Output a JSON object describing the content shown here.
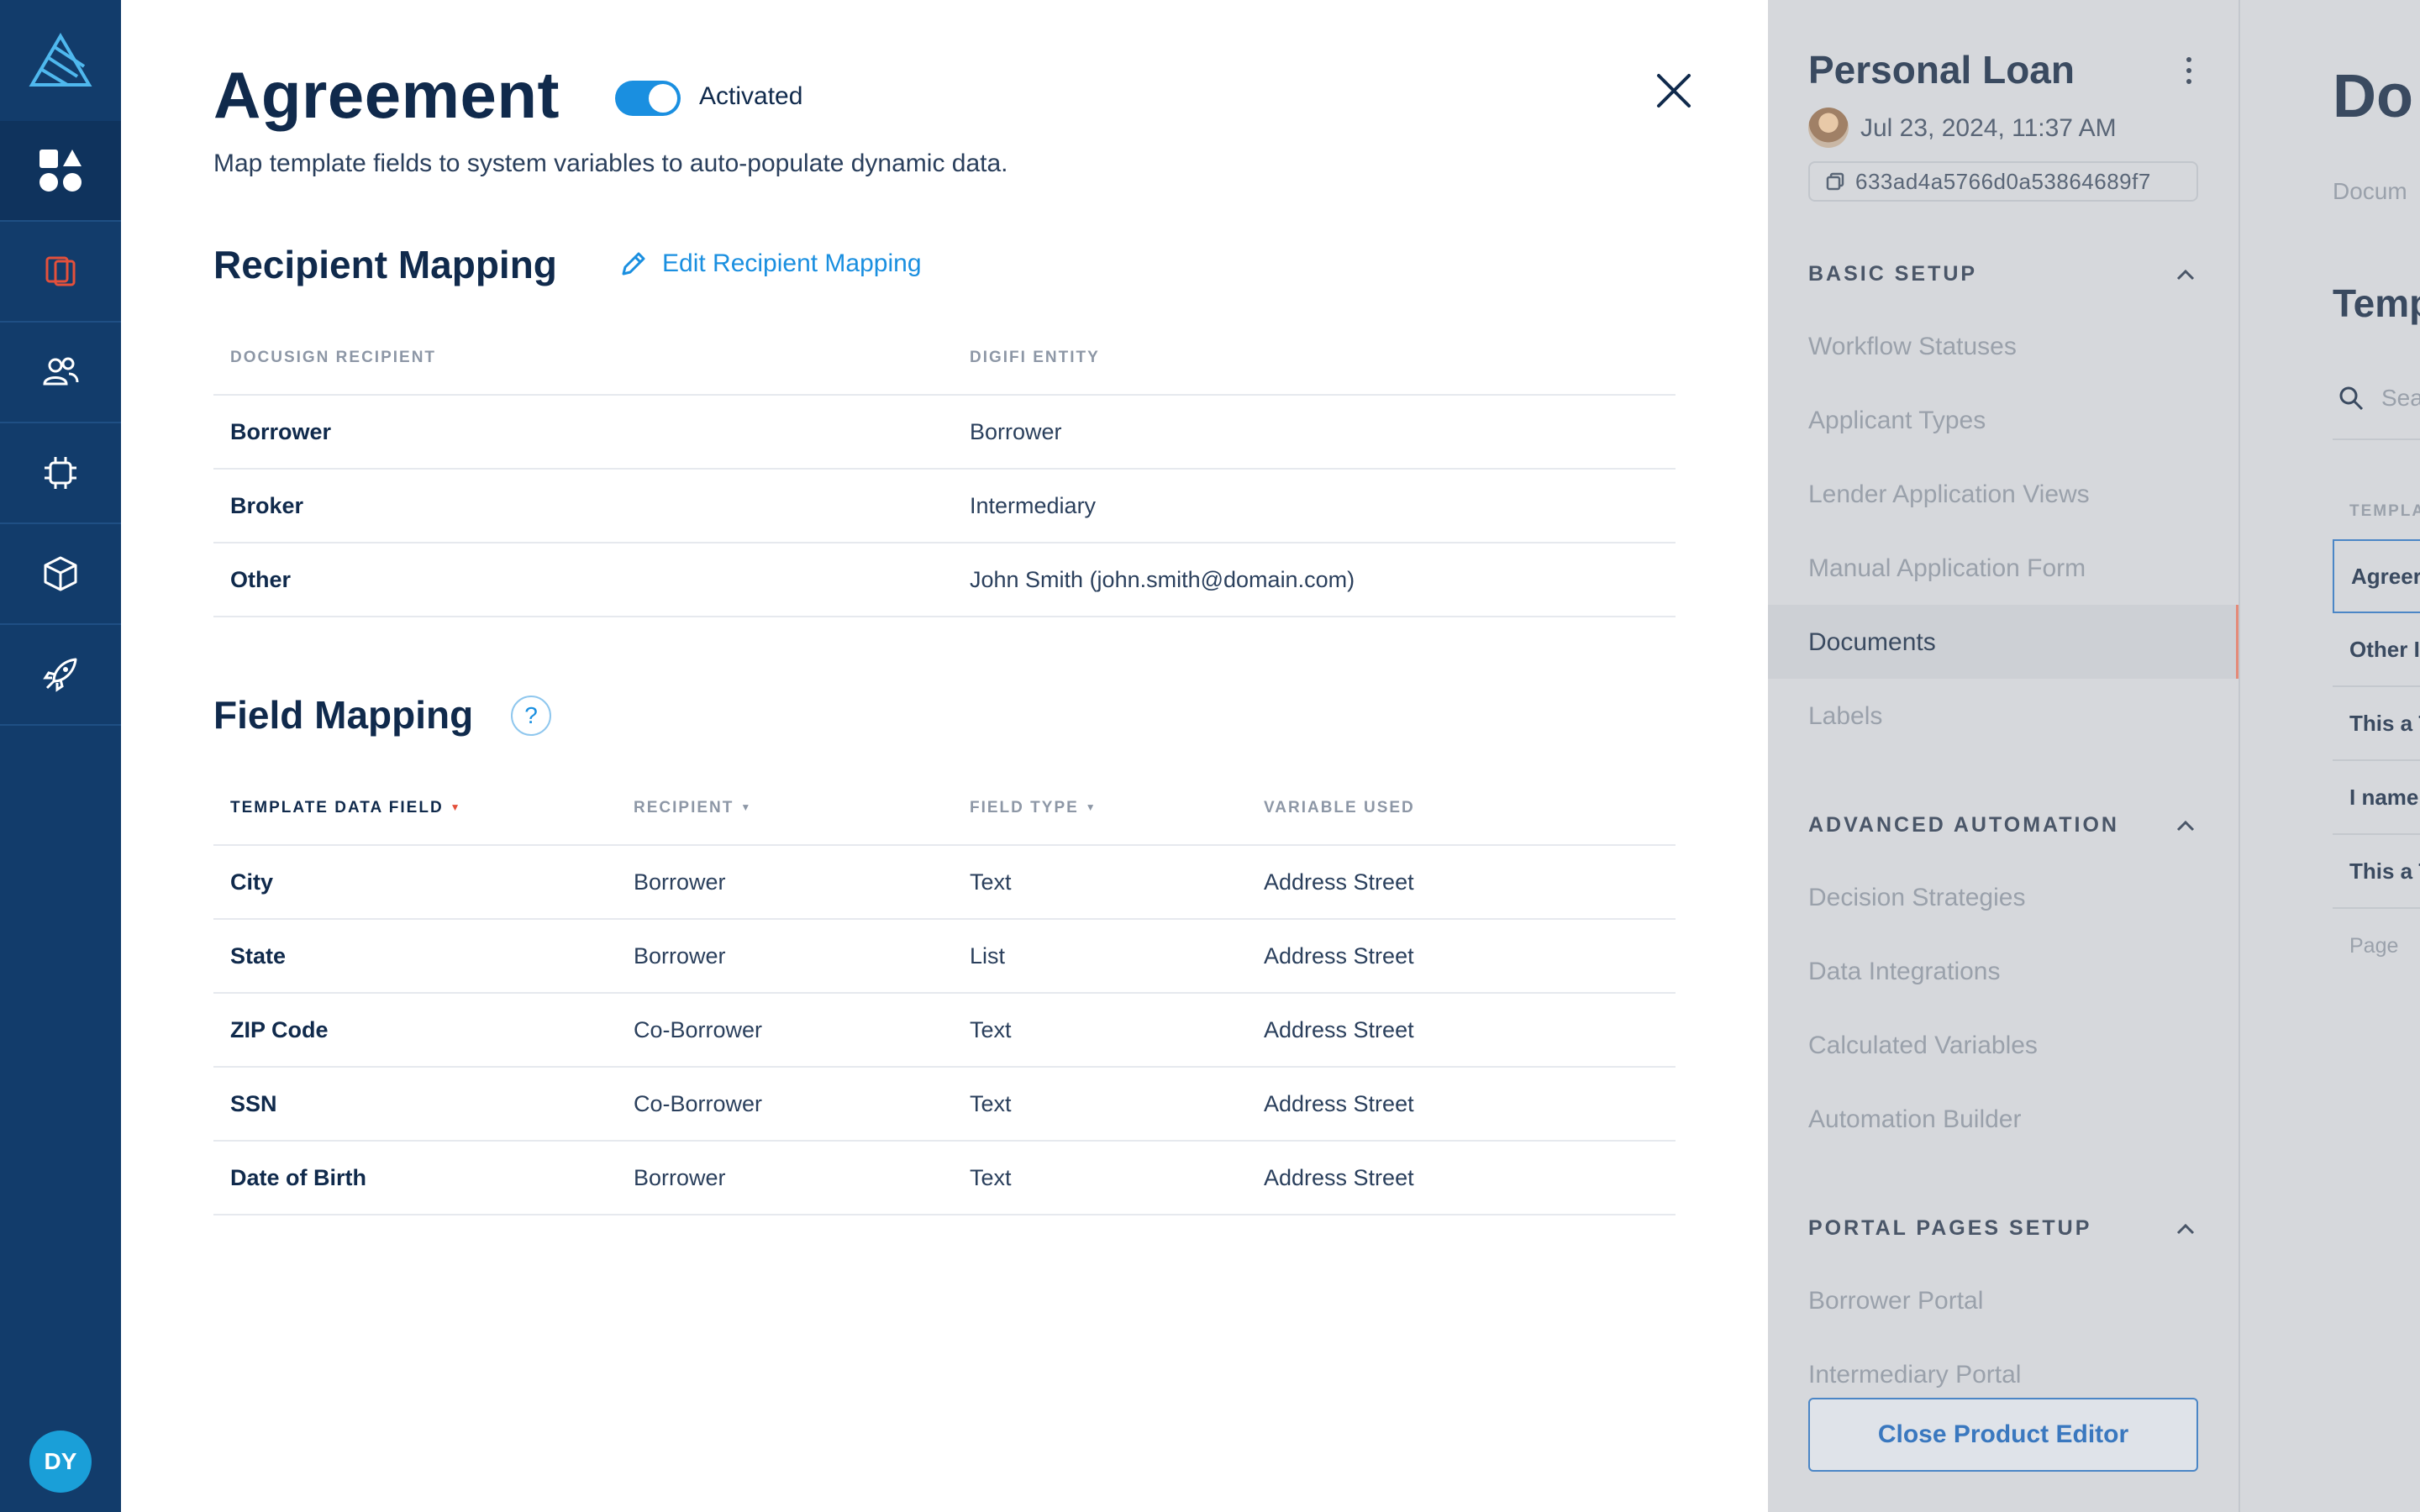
{
  "modal": {
    "title": "Agreement",
    "toggle_label": "Activated",
    "toggle_on": true,
    "subtitle": "Map template fields to system variables to auto-populate dynamic data.",
    "recipient_section": {
      "title": "Recipient Mapping",
      "edit_label": "Edit Recipient Mapping",
      "columns": [
        "DOCUSIGN RECIPIENT",
        "DIGIFI ENTITY"
      ],
      "rows": [
        {
          "recipient": "Borrower",
          "entity": "Borrower"
        },
        {
          "recipient": "Broker",
          "entity": "Intermediary"
        },
        {
          "recipient": "Other",
          "entity": "John Smith (john.smith@domain.com)"
        }
      ]
    },
    "field_section": {
      "title": "Field Mapping",
      "help": "?",
      "columns": [
        "TEMPLATE DATA FIELD",
        "RECIPIENT",
        "FIELD TYPE",
        "VARIABLE USED"
      ],
      "rows": [
        {
          "field": "City",
          "recipient": "Borrower",
          "type": "Text",
          "variable": "Address Street"
        },
        {
          "field": "State",
          "recipient": "Borrower",
          "type": "List",
          "variable": "Address Street"
        },
        {
          "field": "ZIP Code",
          "recipient": "Co-Borrower",
          "type": "Text",
          "variable": "Address Street"
        },
        {
          "field": "SSN",
          "recipient": "Co-Borrower",
          "type": "Text",
          "variable": "Address Street"
        },
        {
          "field": "Date of Birth",
          "recipient": "Borrower",
          "type": "Text",
          "variable": "Address Street"
        }
      ]
    }
  },
  "rail": {
    "user_initials": "DY",
    "icons": [
      "logo-icon",
      "shapes-icon",
      "book-icon",
      "users-icon",
      "chip-icon",
      "cube-icon",
      "rocket-icon"
    ]
  },
  "editor": {
    "product_name": "Personal Loan",
    "date": "Jul 23, 2024, 11:37 AM",
    "id": "633ad4a5766d0a53864689f7",
    "groups": [
      {
        "title": "BASIC SETUP",
        "items": [
          "Workflow Statuses",
          "Applicant Types",
          "Lender Application Views",
          "Manual Application Form",
          "Documents",
          "Labels"
        ]
      },
      {
        "title": "ADVANCED AUTOMATION",
        "items": [
          "Decision Strategies",
          "Data Integrations",
          "Calculated Variables",
          "Automation Builder"
        ]
      },
      {
        "title": "PORTAL PAGES SETUP",
        "items": [
          "Borrower Portal",
          "Intermediary Portal"
        ]
      }
    ],
    "selected_item": "Documents",
    "close_button": "Close Product Editor"
  },
  "docs": {
    "title": "Do",
    "breadcrumb": "Docum",
    "subtitle": "Temp",
    "search_placeholder": "Sea",
    "column": "TEMPLA",
    "rows": [
      "Agreer",
      "Other I",
      "This a T",
      "I name",
      "This a T"
    ],
    "pagination": "Page"
  },
  "colors": {
    "rail": "#123c6b",
    "accent": "#1a8fe0",
    "sort_active": "#e4503b",
    "overlay": "#d6d8dc"
  }
}
